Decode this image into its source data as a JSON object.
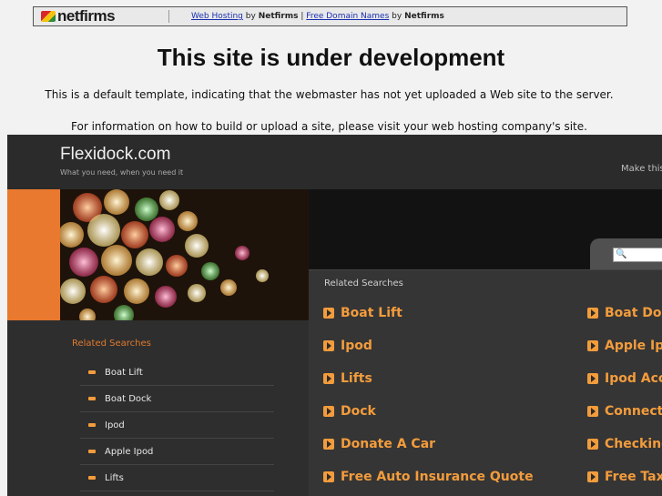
{
  "netfirms_bar": {
    "logo_text": "netfirms",
    "link1": "Web Hosting",
    "by1": "by",
    "brand1": "Netfirms",
    "separator": "|",
    "link2": "Free Domain Names",
    "by2": "by",
    "brand2": "Netfirms"
  },
  "notice": {
    "title": "This site is under development",
    "line1": "This is a default template, indicating that the webmaster has not yet uploaded a Web site to the server.",
    "line2": "For information on how to build or upload a site, please visit your web hosting company's site."
  },
  "parked": {
    "site_name": "Flexidock.com",
    "tagline": "What you need, when you need it",
    "make_offer": "Make this",
    "related_heading": "Related Searches",
    "left_heading": "Related Searches",
    "left_items": [
      "Boat Lift",
      "Boat Dock",
      "Ipod",
      "Apple Ipod",
      "Lifts"
    ],
    "col1": [
      "Boat Lift",
      "Ipod",
      "Lifts",
      "Dock",
      "Donate A Car",
      "Free Auto Insurance Quote"
    ],
    "col2": [
      "Boat Doc",
      "Apple Ipo",
      "Ipod Acc",
      "Connecto",
      "Checking",
      "Free Tax"
    ]
  },
  "colors": {
    "accent_orange": "#f39c3c",
    "header_orange": "#e9792e",
    "dark_bg": "#2a2a2a"
  },
  "icons": {
    "arrow": "orange-arrow-icon",
    "search": "search-icon",
    "dash": "orange-dash-icon"
  }
}
